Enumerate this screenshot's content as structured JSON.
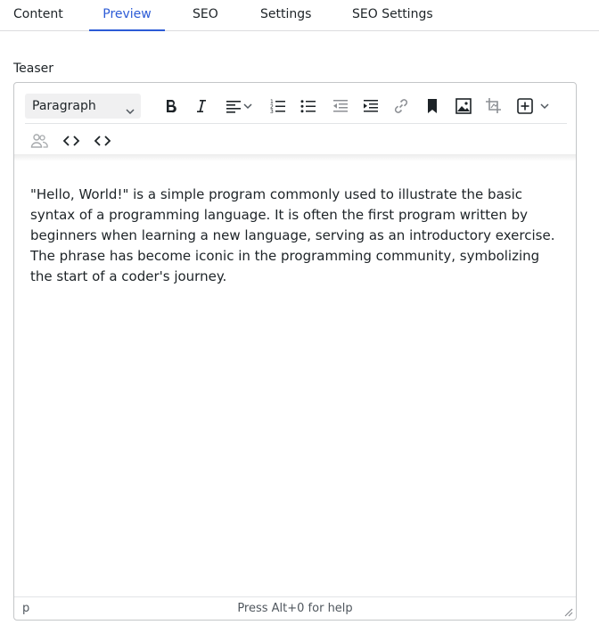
{
  "tabs": [
    {
      "label": "Content",
      "active": false
    },
    {
      "label": "Preview",
      "active": true
    },
    {
      "label": "SEO",
      "active": false
    },
    {
      "label": "Settings",
      "active": false
    },
    {
      "label": "SEO Settings",
      "active": false
    }
  ],
  "field": {
    "label": "Teaser"
  },
  "toolbar": {
    "format_value": "Paragraph",
    "row1_icons": [
      "bold-icon",
      "italic-icon",
      "align-left-icon",
      "numbered-list-icon",
      "bulleted-list-icon",
      "outdent-icon",
      "indent-icon",
      "link-icon",
      "bookmark-icon",
      "image-icon",
      "crop-icon",
      "insert-icon"
    ],
    "row2_icons": [
      "users-icon",
      "source-code-icon",
      "code-icon"
    ]
  },
  "editor": {
    "content": "\"Hello, World!\" is a simple program commonly used to illustrate the basic syntax of a programming language. It is often the first program written by beginners when learning a new language, serving as an introductory exercise. The phrase has become iconic in the programming community, symbolizing the start of a coder's journey."
  },
  "statusbar": {
    "path": "p",
    "help": "Press Alt+0 for help"
  },
  "colors": {
    "accent": "#2c5bd6",
    "text": "#1d2327",
    "border": "#c4c6c8"
  }
}
